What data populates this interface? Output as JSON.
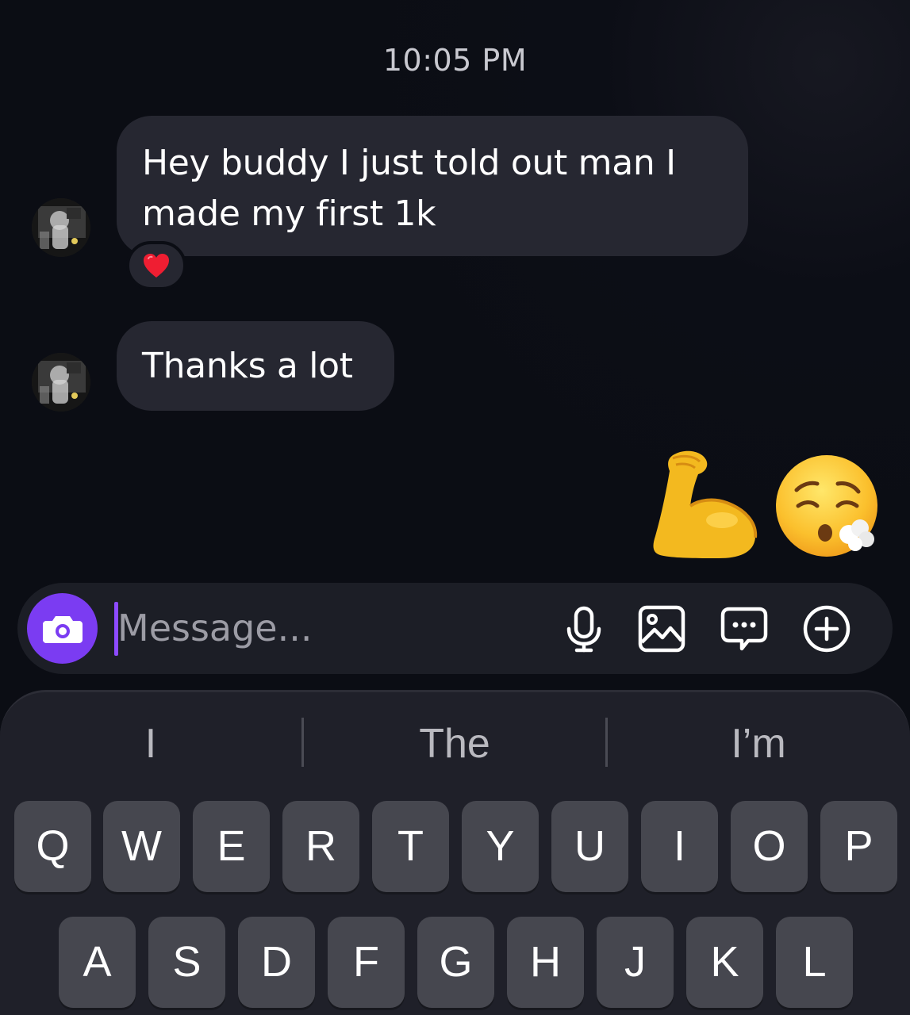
{
  "timestamp": "10:05 PM",
  "messages": [
    {
      "sender": "other",
      "text": "Hey buddy I just told out man I made my first 1k",
      "reaction": "heart"
    },
    {
      "sender": "other",
      "text": "Thanks a lot"
    }
  ],
  "sent_emojis": [
    "flexed-biceps",
    "face-exhaling"
  ],
  "composer": {
    "placeholder": "Message...",
    "value": "",
    "accent_color": "#7b3cf2",
    "tools": [
      "microphone",
      "gallery",
      "sticker-chat",
      "plus"
    ]
  },
  "suggestions": [
    "I",
    "The",
    "I’m"
  ],
  "keyboard": {
    "row1": [
      "Q",
      "W",
      "E",
      "R",
      "T",
      "Y",
      "U",
      "I",
      "O",
      "P"
    ],
    "row2": [
      "A",
      "S",
      "D",
      "F",
      "G",
      "H",
      "J",
      "K",
      "L"
    ]
  }
}
